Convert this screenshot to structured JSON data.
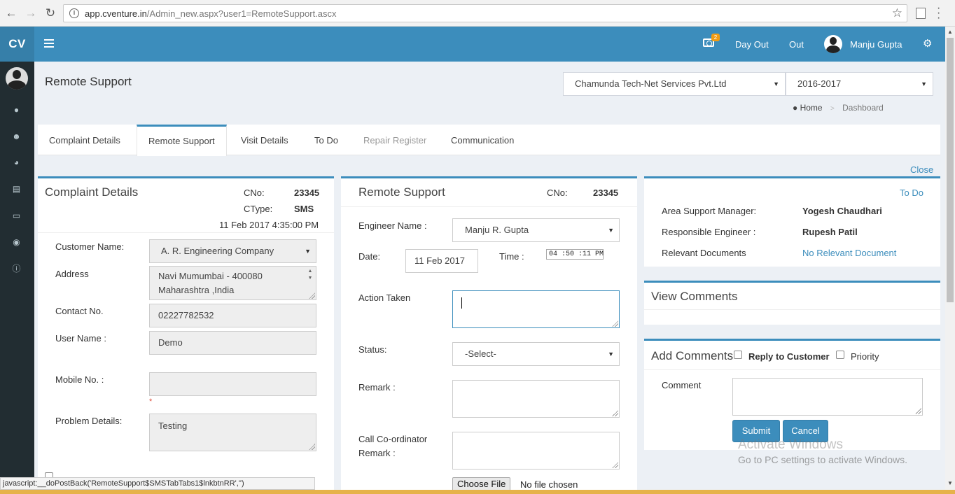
{
  "browser": {
    "url_host": "app.cventure.in",
    "url_path": "/Admin_new.aspx?user1=RemoteSupport.ascx",
    "info_glyph": "i"
  },
  "topbar": {
    "logo": "CV",
    "badge_count": "2",
    "day_out": "Day Out",
    "out": "Out",
    "user_name": "Manju Gupta",
    "accent_color": "#3c8dbc"
  },
  "page": {
    "title": "Remote Support",
    "company_select": "Chamunda Tech-Net Services Pvt.Ltd",
    "year_select": "2016-2017",
    "breadcrumb_home": "Home",
    "breadcrumb_current": "Dashboard",
    "close_label": "Close"
  },
  "tabs": [
    {
      "label": "Complaint Details"
    },
    {
      "label": "Remote Support"
    },
    {
      "label": "Visit Details"
    },
    {
      "label": "To Do"
    },
    {
      "label": "Repair Register"
    },
    {
      "label": "Communication"
    }
  ],
  "complaint": {
    "title": "Complaint Details",
    "cno_label": "CNo:",
    "cno_value": "23345",
    "ctype_label": "CType:",
    "ctype_value": "SMS",
    "datetime": "11 Feb 2017  4:35:00 PM",
    "customer_label": "Customer Name:",
    "customer_value": "A. R. Engineering Company",
    "address_label": "Address",
    "address_line1": "Navi Mumumbai - 400080",
    "address_line2": "Maharashtra ,India",
    "contact_label": "Contact No.",
    "contact_value": "02227782532",
    "user_label": "User Name :",
    "user_value": "Demo",
    "mobile_label": "Mobile No. :",
    "mobile_value": "",
    "required_mark": "*",
    "problem_label": "Problem Details:",
    "problem_value": "Testing"
  },
  "remote": {
    "title": "Remote Support",
    "cno_label": "CNo:",
    "cno_value": "23345",
    "engineer_label": "Engineer Name :",
    "engineer_value": "Manju R. Gupta",
    "date_label": "Date:",
    "date_value": "11 Feb 2017",
    "time_label": "Time :",
    "time_value": "04 :50 :11  PM",
    "action_label": "Action Taken",
    "status_label": "Status:",
    "status_value": "-Select-",
    "remark_label": "Remark :",
    "coordinator_label_1": "Call Co-ordinator",
    "coordinator_label_2": "Remark :",
    "choose_file": "Choose File",
    "no_file": "No file chosen"
  },
  "info": {
    "todo_link": "To Do",
    "asm_label": "Area Support Manager:",
    "asm_value": "Yogesh Chaudhari",
    "re_label": "Responsible Engineer :",
    "re_value": "Rupesh Patil",
    "docs_label": "Relevant Documents",
    "docs_value": "No Relevant Document"
  },
  "view_comments": {
    "title": "View Comments"
  },
  "add_comments": {
    "title": "Add Comments",
    "reply_label": "Reply to Customer",
    "priority_label": "Priority",
    "comment_label": "Comment",
    "submit": "Submit",
    "cancel": "Cancel"
  },
  "status_bar": "javascript:__doPostBack('RemoteSupport$SMSTabTabs1$lnkbtnRR','')",
  "watermark": {
    "line1": "Activate Windows",
    "line2": "Go to PC settings to activate Windows."
  }
}
